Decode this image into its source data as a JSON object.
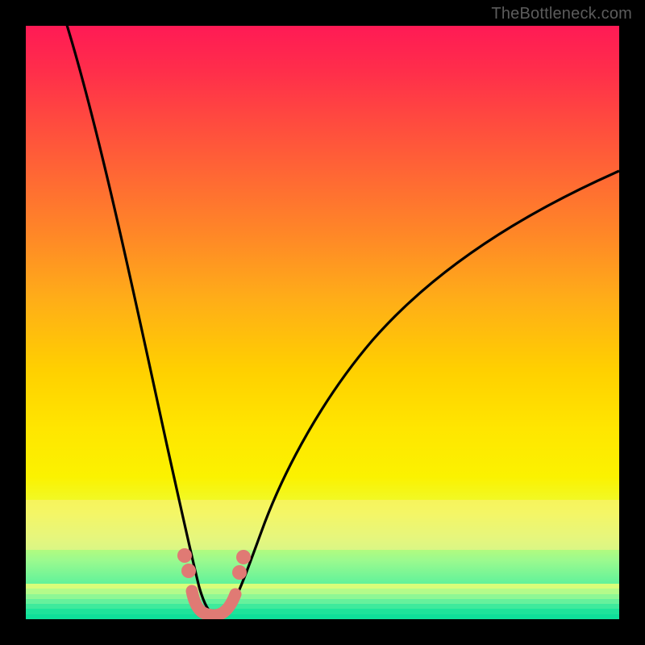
{
  "watermark": "TheBottleneck.com",
  "colors": {
    "gradient_top": "#ff1a55",
    "gradient_bottom": "#0ee29a",
    "curve": "#000000",
    "marker": "#e07a74",
    "frame": "#000000"
  },
  "chart_data": {
    "type": "line",
    "title": "",
    "xlabel": "",
    "ylabel": "",
    "xlim": [
      0,
      100
    ],
    "ylim": [
      0,
      100
    ],
    "series": [
      {
        "name": "bottleneck-curve",
        "x": [
          0,
          2,
          5,
          8,
          11,
          14,
          17,
          20,
          22,
          24,
          25.5,
          27,
          28,
          29,
          30,
          31,
          32,
          33,
          34,
          35,
          36,
          38,
          40,
          43,
          47,
          52,
          58,
          65,
          73,
          82,
          92,
          100
        ],
        "y": [
          100,
          92,
          82,
          72,
          62,
          52,
          42,
          32,
          24,
          16,
          10,
          6,
          3,
          1,
          0.3,
          0,
          0.3,
          1,
          2.5,
          4.5,
          7,
          12,
          17,
          24,
          32,
          40,
          48,
          55,
          62,
          68,
          73,
          77
        ]
      }
    ],
    "markers": [
      {
        "name": "left-upper",
        "x": 25.3,
        "y": 11.5
      },
      {
        "name": "left-lower",
        "x": 26.0,
        "y": 9.0
      },
      {
        "name": "right-upper",
        "x": 35.7,
        "y": 11.0
      },
      {
        "name": "right-lower",
        "x": 35.0,
        "y": 8.5
      }
    ],
    "minimum_band": {
      "x_start": 27.5,
      "x_end": 34.0,
      "y": 2.0
    }
  }
}
